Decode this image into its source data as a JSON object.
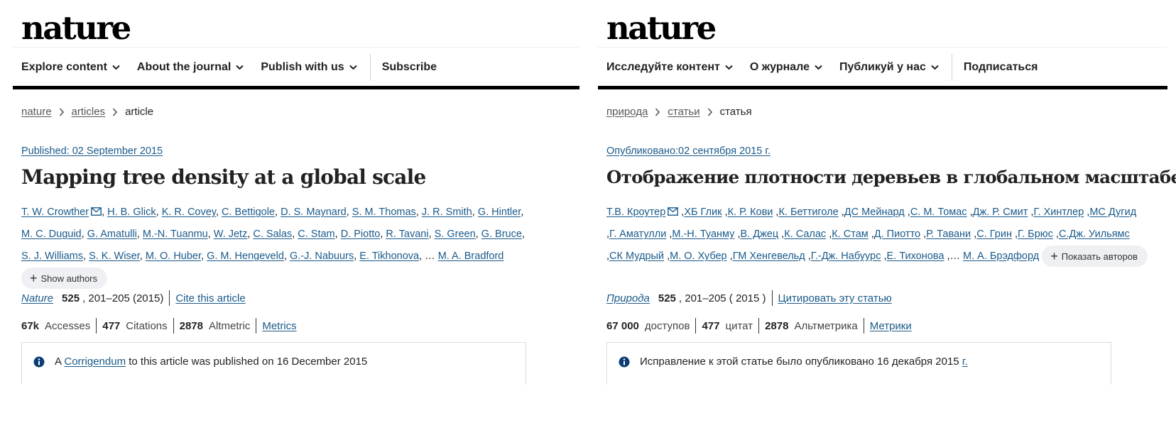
{
  "en": {
    "logo": "nature",
    "nav": {
      "explore": "Explore content",
      "about": "About the journal",
      "publish": "Publish with us",
      "subscribe": "Subscribe"
    },
    "breadcrumb": [
      "nature",
      "articles",
      "article"
    ],
    "published": "Published: 02 September 2015",
    "title": "Mapping tree density at a global scale",
    "authors": [
      "T. W. Crowther",
      "H. B. Glick",
      "K. R. Covey",
      "C. Bettigole",
      "D. S. Maynard",
      "S. M. Thomas",
      "J. R. Smith",
      "G. Hintler",
      "M. C. Duguid",
      "G. Amatulli",
      "M.-N. Tuanmu",
      "W. Jetz",
      "C. Salas",
      "C. Stam",
      "D. Piotto",
      "R. Tavani",
      "S. Green",
      "G. Bruce",
      "S. J. Williams",
      "S. K. Wiser",
      "M. O. Huber",
      "G. M. Hengeveld",
      "G.-J. Nabuurs",
      "E. Tikhonova",
      "M. A. Bradford"
    ],
    "ellipsis": "…",
    "show_authors": "Show authors",
    "journal": "Nature",
    "volume": "525",
    "pages": ", 201–205 (2015)",
    "cite": "Cite this article",
    "metrics": {
      "accesses_num": "67k",
      "accesses_label": "Accesses",
      "citations_num": "477",
      "citations_label": "Citations",
      "altmetric_num": "2878",
      "altmetric_label": "Altmetric",
      "metrics_link": "Metrics"
    },
    "notice": {
      "before": "A",
      "link": "Corrigendum",
      "after": "to this article was published on 16 December 2015"
    }
  },
  "ru": {
    "logo": "nature",
    "nav": {
      "explore": "Исследуйте контент",
      "about": "О журнале",
      "publish": "Публикуй у нас",
      "subscribe": "Подписаться"
    },
    "breadcrumb": [
      "природа",
      "статьи",
      "статья"
    ],
    "published": "Опубликовано:02 сентября 2015 г.",
    "title": "Отображение плотности деревьев в глобальном масштабе",
    "authors": [
      "Т.В. Кроутер",
      "ХБ Глик",
      "К. Р. Кови",
      "К. Беттиголе",
      "ДС Мейнард",
      "С. М. Томас",
      "Дж. Р. Смит",
      "Г. Хинтлер",
      "МС Дугид",
      "Г. Аматулли",
      "М.-Н. Туанму",
      "В. Джец",
      "К. Салас",
      "К. Стам",
      "Д. Пиотто",
      "Р. Тавани",
      "С. Грин",
      "Г. Брюс",
      "С.Дж. Уильямс",
      "СК Мудрый",
      "М. О. Хубер",
      "ГМ Хенгевельд",
      "Г.-Дж. Набуурс",
      "Е. Тихонова",
      "М. А. Брэдфорд"
    ],
    "ellipsis": "…",
    "show_authors": "Показать авторов",
    "journal": "Природа",
    "volume": "525",
    "pages": ", 201–205 ( 2015 )",
    "cite": "Цитировать эту статью",
    "metrics": {
      "accesses_num": "67 000",
      "accesses_label": "доступов",
      "citations_num": "477",
      "citations_label": "цитат",
      "altmetric_num": "2878",
      "altmetric_label": "Альтметрика",
      "metrics_link": "Метрики"
    },
    "notice": {
      "text": "Исправление к этой статье было опубликовано 16 декабря 2015",
      "link": "г."
    }
  },
  "colors": {
    "link": "#1a5a8a",
    "info_icon": "#0c3d74",
    "rule": "#000000"
  },
  "icons": {
    "mail": "mail-icon",
    "chevron": "chevron-down-icon",
    "crumb": "chevron-right-icon",
    "info": "info-icon",
    "plus": "plus-icon"
  }
}
